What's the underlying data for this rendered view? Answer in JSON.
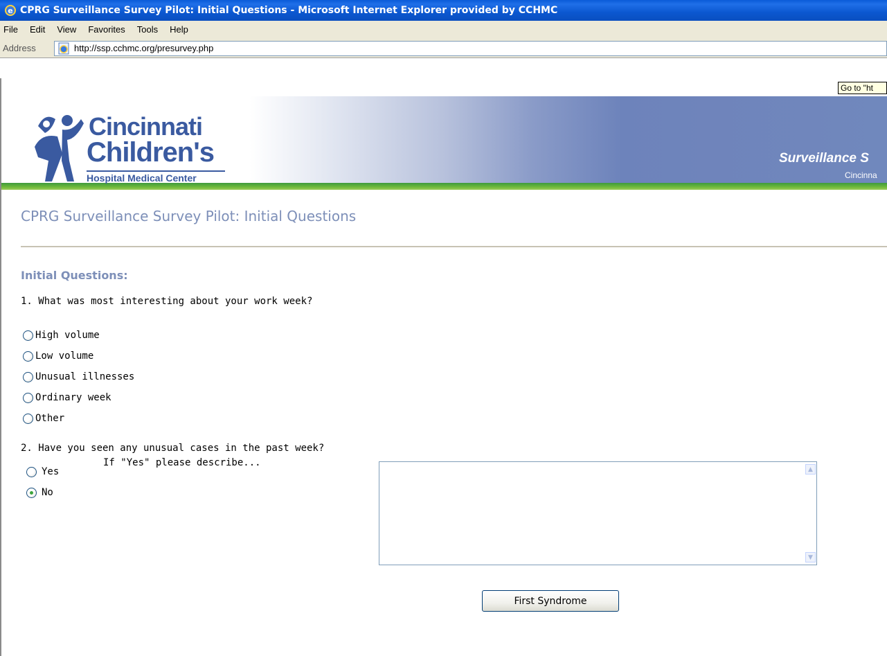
{
  "window": {
    "title": "CPRG Surveillance Survey Pilot: Initial Questions - Microsoft Internet Explorer provided by CCHMC"
  },
  "menu": {
    "items": [
      "File",
      "Edit",
      "View",
      "Favorites",
      "Tools",
      "Help"
    ]
  },
  "address": {
    "label": "Address",
    "url": "http://ssp.cchmc.org/presurvey.php"
  },
  "tooltip": "Go to \"ht",
  "banner": {
    "logo_line1": "Cincinnati",
    "logo_line2": "Children's",
    "logo_line3": "Hospital Medical Center",
    "title": "Surveillance S",
    "subtitle": "Cincinna"
  },
  "page": {
    "title": "CPRG Surveillance Survey Pilot: Initial Questions",
    "section_heading": "Initial Questions:",
    "q1": {
      "text": "1. What was most interesting about your work week?",
      "options": [
        "High volume",
        "Low volume",
        "Unusual illnesses",
        "Ordinary week",
        "Other"
      ]
    },
    "q2": {
      "text": "2. Have you seen any unusual cases in the past week?",
      "options": [
        "Yes",
        "No"
      ],
      "selected": "No",
      "describe_label": "If \"Yes\" please describe...",
      "description_value": ""
    },
    "submit_label": "First Syndrome"
  },
  "colors": {
    "heading": "#7d8fb8",
    "logo_blue": "#3a5aa0",
    "accent_green": "#6fb83b"
  }
}
